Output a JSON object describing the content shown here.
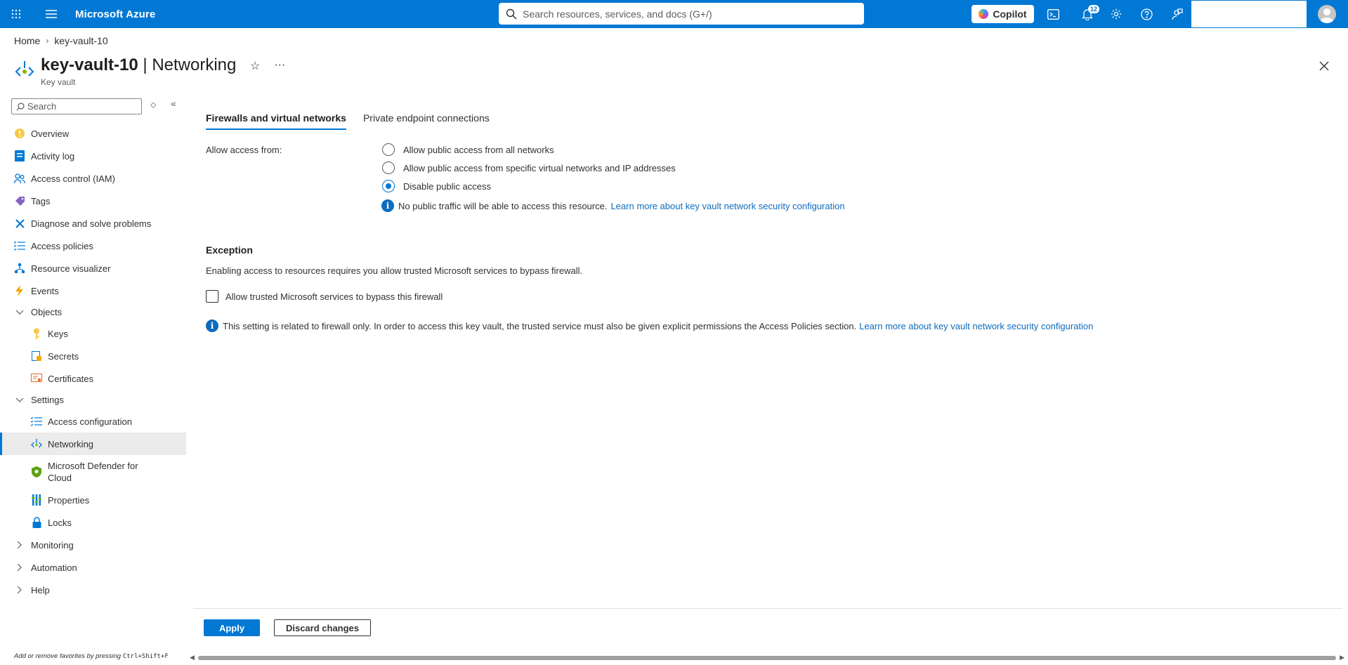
{
  "topbar": {
    "brand": "Microsoft Azure",
    "search_placeholder": "Search resources, services, and docs (G+/)",
    "copilot_label": "Copilot",
    "notification_count": "12"
  },
  "breadcrumb": {
    "home": "Home",
    "current": "key-vault-10"
  },
  "page": {
    "resource_name": "key-vault-10",
    "separator": " | ",
    "blade_name": "Networking",
    "resource_type": "Key vault",
    "more_label": "···"
  },
  "sidebar": {
    "search_placeholder": "Search",
    "items": [
      {
        "label": "Overview"
      },
      {
        "label": "Activity log"
      },
      {
        "label": "Access control (IAM)"
      },
      {
        "label": "Tags"
      },
      {
        "label": "Diagnose and solve problems"
      },
      {
        "label": "Access policies"
      },
      {
        "label": "Resource visualizer"
      },
      {
        "label": "Events"
      }
    ],
    "objects_group": "Objects",
    "objects_items": [
      {
        "label": "Keys"
      },
      {
        "label": "Secrets"
      },
      {
        "label": "Certificates"
      }
    ],
    "settings_group": "Settings",
    "settings_items": [
      {
        "label": "Access configuration"
      },
      {
        "label": "Networking"
      },
      {
        "label": "Microsoft Defender for Cloud"
      },
      {
        "label": "Properties"
      },
      {
        "label": "Locks"
      }
    ],
    "monitoring_group": "Monitoring",
    "automation_group": "Automation",
    "help_group": "Help",
    "fav_hint_prefix": "Add or remove favorites by pressing ",
    "fav_hint_keys": "Ctrl+Shift+F"
  },
  "main": {
    "tabs": [
      {
        "label": "Firewalls and virtual networks"
      },
      {
        "label": "Private endpoint connections"
      }
    ],
    "allow_access_label": "Allow access from:",
    "radio_options": [
      {
        "label": "Allow public access from all networks"
      },
      {
        "label": "Allow public access from specific virtual networks and IP addresses"
      },
      {
        "label": "Disable public access"
      }
    ],
    "selected_option": "Disable public access",
    "info_text_1": "No public traffic will be able to access this resource.",
    "info_link_1": "Learn more about key vault network security configuration",
    "exception_heading": "Exception",
    "exception_desc": "Enabling access to resources requires you allow trusted Microsoft services to bypass firewall.",
    "bypass_checkbox_label": "Allow trusted Microsoft services to bypass this firewall",
    "bypass_checked": false,
    "info_text_2": "This setting is related to firewall only. In order to access this key vault, the trusted service must also be given explicit permissions the Access Policies section.",
    "info_link_2": "Learn more about key vault network security configuration"
  },
  "footer": {
    "apply_label": "Apply",
    "discard_label": "Discard changes"
  },
  "colors": {
    "accent": "#0078d4",
    "link": "#0f6cbd"
  }
}
